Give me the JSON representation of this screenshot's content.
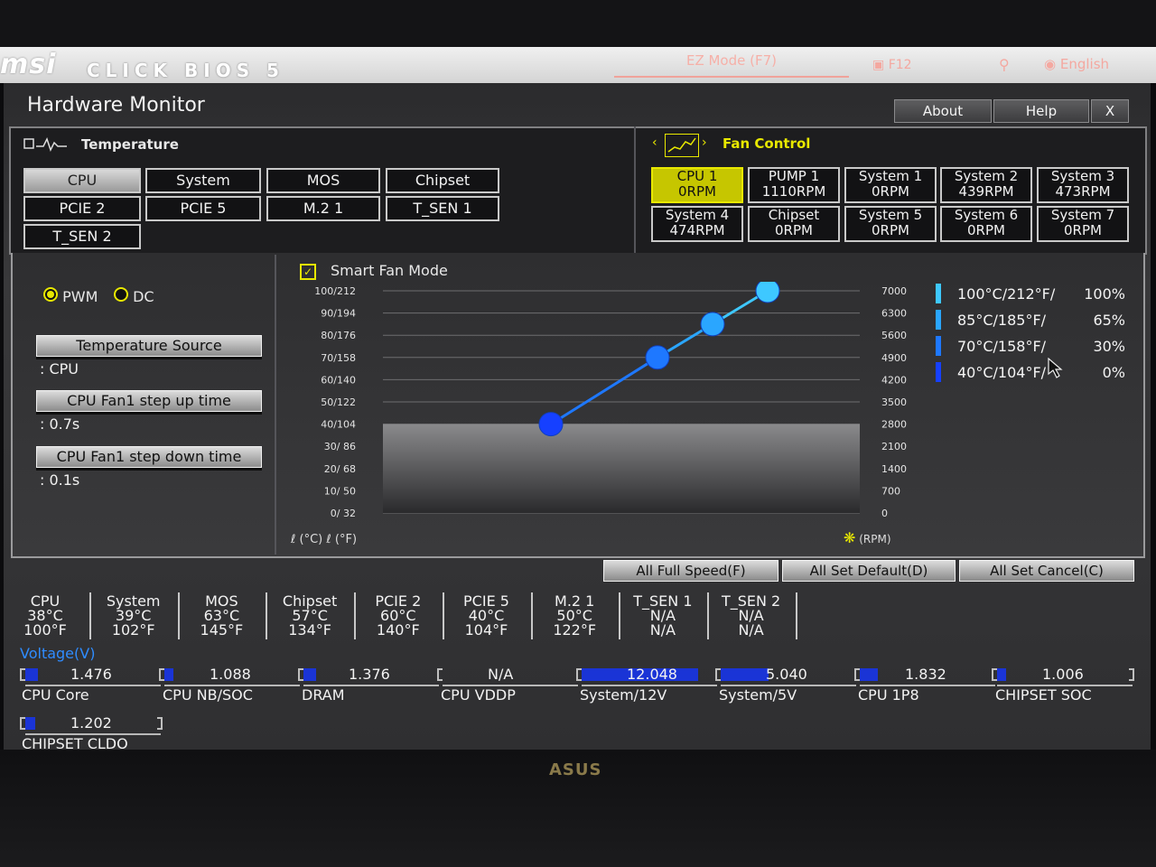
{
  "header": {
    "logo": "msi",
    "product": "CLICK BIOS 5",
    "ez_mode": "EZ Mode (F7)",
    "screenshot": "F12",
    "language": "English"
  },
  "page": {
    "title": "Hardware Monitor",
    "top_buttons": [
      "About",
      "Help",
      "X"
    ]
  },
  "temperature": {
    "heading": "Temperature",
    "sources": [
      "CPU",
      "System",
      "MOS",
      "Chipset",
      "PCIE 2",
      "PCIE 5",
      "M.2 1",
      "T_SEN 1",
      "T_SEN 2"
    ],
    "selected": "CPU"
  },
  "fan_control": {
    "heading": "Fan Control",
    "fans": [
      {
        "name": "CPU 1",
        "rpm": "0RPM"
      },
      {
        "name": "PUMP 1",
        "rpm": "1110RPM"
      },
      {
        "name": "System 1",
        "rpm": "0RPM"
      },
      {
        "name": "System 2",
        "rpm": "439RPM"
      },
      {
        "name": "System 3",
        "rpm": "473RPM"
      },
      {
        "name": "System 4",
        "rpm": "474RPM"
      },
      {
        "name": "Chipset",
        "rpm": "0RPM"
      },
      {
        "name": "System 5",
        "rpm": "0RPM"
      },
      {
        "name": "System 6",
        "rpm": "0RPM"
      },
      {
        "name": "System 7",
        "rpm": "0RPM"
      }
    ],
    "selected": "CPU 1"
  },
  "settings": {
    "mode_pwm": "PWM",
    "mode_dc": "DC",
    "mode_selected": "PWM",
    "temp_source_label": "Temperature Source",
    "temp_source_value": ": CPU",
    "step_up_label": "CPU Fan1 step up time",
    "step_up_value": ": 0.7s",
    "step_down_label": "CPU Fan1 step down time",
    "step_down_value": ": 0.1s"
  },
  "chart_data": {
    "type": "line",
    "title": "Smart Fan Mode",
    "smart_fan_checked": true,
    "y_left_ticks": [
      "100/212",
      "90/194",
      "80/176",
      "70/158",
      "60/140",
      "50/122",
      "40/104",
      "30/ 86",
      "20/ 68",
      "10/ 50",
      "0/ 32"
    ],
    "y_right_ticks": [
      "7000",
      "6300",
      "5600",
      "4900",
      "4200",
      "3500",
      "2800",
      "2100",
      "1400",
      "700",
      "0"
    ],
    "x_unit_c": "(°C)",
    "x_unit_f": "(°F)",
    "rpm_unit": "(RPM)",
    "ylim_celsius": [
      0,
      100
    ],
    "points": [
      {
        "temp_c": 40,
        "percent": 0
      },
      {
        "temp_c": 70,
        "percent": 30
      },
      {
        "temp_c": 85,
        "percent": 65
      },
      {
        "temp_c": 100,
        "percent": 100
      }
    ],
    "legend": [
      {
        "temp": "100°C/212°F/",
        "percent": "100%",
        "color": "#3ec8ff"
      },
      {
        "temp": "85°C/185°F/",
        "percent": "65%",
        "color": "#2aa6ff"
      },
      {
        "temp": "70°C/158°F/",
        "percent": "30%",
        "color": "#1e78ff"
      },
      {
        "temp": "40°C/104°F/",
        "percent": "0%",
        "color": "#1640ff"
      }
    ]
  },
  "actions": [
    "All Full Speed(F)",
    "All Set Default(D)",
    "All Set Cancel(C)"
  ],
  "temps": [
    {
      "name": "CPU",
      "c": "38°C",
      "f": "100°F"
    },
    {
      "name": "System",
      "c": "39°C",
      "f": "102°F"
    },
    {
      "name": "MOS",
      "c": "63°C",
      "f": "145°F"
    },
    {
      "name": "Chipset",
      "c": "57°C",
      "f": "134°F"
    },
    {
      "name": "PCIE 2",
      "c": "60°C",
      "f": "140°F"
    },
    {
      "name": "PCIE 5",
      "c": "40°C",
      "f": "104°F"
    },
    {
      "name": "M.2 1",
      "c": "50°C",
      "f": "122°F"
    },
    {
      "name": "T_SEN 1",
      "c": "N/A",
      "f": "N/A"
    },
    {
      "name": "T_SEN 2",
      "c": "N/A",
      "f": "N/A"
    }
  ],
  "voltage": {
    "heading": "Voltage(V)",
    "rows": [
      {
        "name": "CPU Core",
        "value": "1.476",
        "fill": 0.1
      },
      {
        "name": "CPU NB/SOC",
        "value": "1.088",
        "fill": 0.07
      },
      {
        "name": "DRAM",
        "value": "1.376",
        "fill": 0.1
      },
      {
        "name": "CPU VDDP",
        "value": "N/A",
        "fill": 0
      },
      {
        "name": "System/12V",
        "value": "12.048",
        "fill": 0.92
      },
      {
        "name": "System/5V",
        "value": "5.040",
        "fill": 0.38
      },
      {
        "name": "CPU 1P8",
        "value": "1.832",
        "fill": 0.14
      },
      {
        "name": "CHIPSET SOC",
        "value": "1.006",
        "fill": 0.07
      },
      {
        "name": "CHIPSET CLDO",
        "value": "1.202",
        "fill": 0.08
      }
    ]
  },
  "monitor_brand": "ASUS"
}
